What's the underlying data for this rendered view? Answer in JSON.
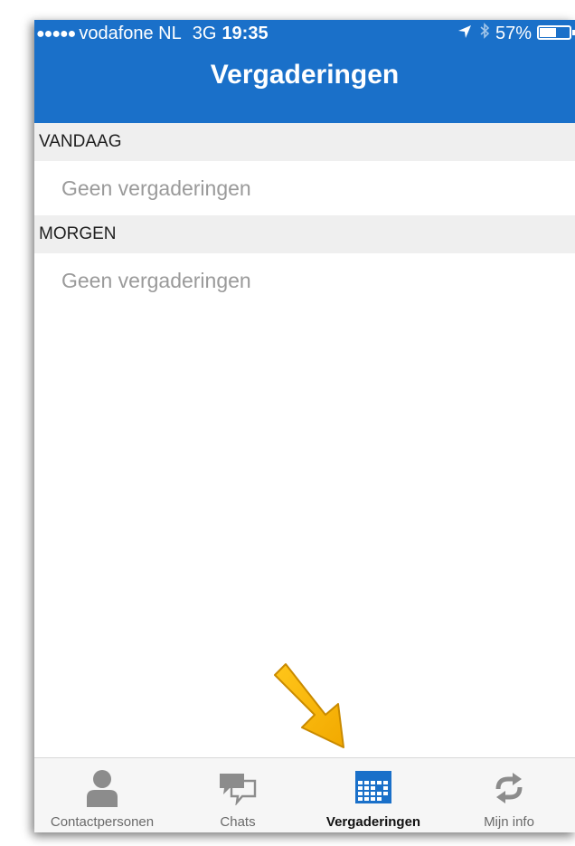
{
  "status_bar": {
    "signal_dots": "●●●●●",
    "carrier": "vodafone NL",
    "network": "3G",
    "time": "19:35",
    "battery_percent": "57%",
    "battery_level": 0.57,
    "icons": [
      "location-arrow-icon",
      "bluetooth-icon",
      "battery-icon"
    ]
  },
  "header": {
    "title": "Vergaderingen",
    "background_color": "#1a70c9"
  },
  "sections": [
    {
      "header": "VANDAAG",
      "empty_text": "Geen vergaderingen"
    },
    {
      "header": "MORGEN",
      "empty_text": "Geen vergaderingen"
    }
  ],
  "tab_bar": {
    "active_tab": "Vergaderingen",
    "tabs": [
      {
        "label": "Contactpersonen",
        "icon": "person-icon"
      },
      {
        "label": "Chats",
        "icon": "chat-bubbles-icon"
      },
      {
        "label": "Vergaderingen",
        "icon": "calendar-icon"
      },
      {
        "label": "Mijn info",
        "icon": "sync-arrows-icon"
      }
    ]
  },
  "annotation": {
    "icon": "highlight-arrow-icon",
    "color": "#f5b800"
  }
}
